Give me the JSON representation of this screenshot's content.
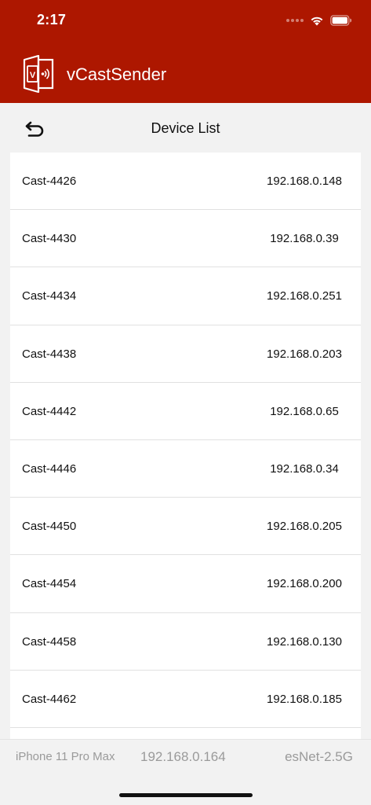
{
  "status_bar": {
    "time": "2:17",
    "icons": [
      "signal-dots-icon",
      "wifi-icon",
      "battery-icon"
    ]
  },
  "header": {
    "app_title": "vCastSender",
    "logo_icon": "vcast-logo-icon",
    "logo_letter": "V"
  },
  "nav": {
    "back_icon": "back-arrow-icon",
    "title": "Device List"
  },
  "devices": [
    {
      "name": "Cast-4426",
      "ip": "192.168.0.148"
    },
    {
      "name": "Cast-4430",
      "ip": "192.168.0.39"
    },
    {
      "name": "Cast-4434",
      "ip": "192.168.0.251"
    },
    {
      "name": "Cast-4438",
      "ip": "192.168.0.203"
    },
    {
      "name": "Cast-4442",
      "ip": "192.168.0.65"
    },
    {
      "name": "Cast-4446",
      "ip": "192.168.0.34"
    },
    {
      "name": "Cast-4450",
      "ip": "192.168.0.205"
    },
    {
      "name": "Cast-4454",
      "ip": "192.168.0.200"
    },
    {
      "name": "Cast-4458",
      "ip": "192.168.0.130"
    },
    {
      "name": "Cast-4462",
      "ip": "192.168.0.185"
    }
  ],
  "footer": {
    "device_model": "iPhone 11 Pro Max",
    "local_ip": "192.168.0.164",
    "network_name": "esNet-2.5G"
  },
  "colors": {
    "brand": "#ad1700",
    "background": "#f2f2f2",
    "row_background": "#ffffff",
    "footer_text": "#9a9a9a"
  }
}
